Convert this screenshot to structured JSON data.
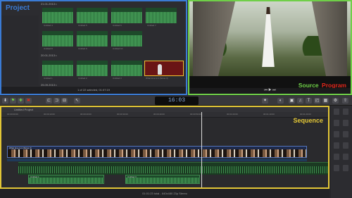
{
  "browser": {
    "label": "Project",
    "events": [
      "21.01.2013 г.",
      "20.01.2013 г.",
      "25.09.2013 г."
    ],
    "clips": [
      {
        "name": "Untitled 4"
      },
      {
        "name": "Untitled 5"
      },
      {
        "name": "Untitled 6"
      },
      {
        "name": "Untitled 7"
      },
      {
        "name": "Untitled 8"
      },
      {
        "name": "Untitled 9"
      },
      {
        "name": "Untitled 10"
      },
      {
        "name": "Untitled 1"
      },
      {
        "name": "Untitled 2"
      },
      {
        "name": "Untitled 3"
      },
      {
        "name": "What time is it (Sirius 3)"
      },
      {
        "name": "Untitled 11"
      }
    ],
    "status": "1 of 22 selected, 01:07:19"
  },
  "viewer": {
    "source": "Source",
    "program": "Program"
  },
  "toolbar": {
    "timecode": "16:03"
  },
  "timeline": {
    "title": "Untitled Project",
    "label": "Sequence",
    "ticks": [
      "00:00:00:00",
      "00:00:10:00",
      "00:00:20:00",
      "00:00:30:00",
      "00:00:40:00",
      "00:00:50:00",
      "00:01:00:00",
      "00:01:10:00",
      "00:01:20:00"
    ],
    "storyline_name": "What time is it (Sirius 3)",
    "audio1": "Untitled 1",
    "audio2": "Untitled 3",
    "status": "01:01:23 total - 640x480 23p Stereo"
  }
}
